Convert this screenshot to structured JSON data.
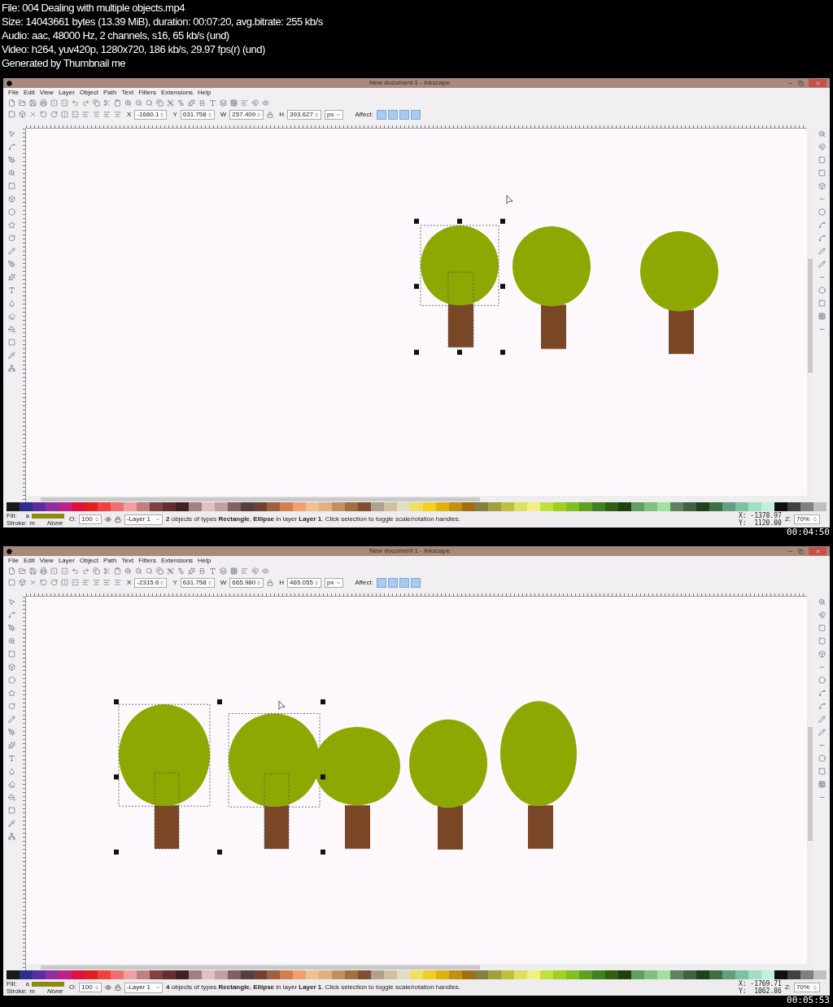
{
  "header": [
    "File: 004 Dealing with multiple objects.mp4",
    "Size: 14043661 bytes (13.39 MiB), duration: 00:07:20, avg.bitrate: 255 kb/s",
    "Audio: aac, 48000 Hz, 2 channels, s16, 65 kb/s (und)",
    "Video: h264, yuv420p, 1280x720, 186 kb/s, 29.97 fps(r) (und)",
    "Generated by Thumbnail me"
  ],
  "frames": [
    {
      "title": "New document 1 - Inkscape",
      "menu": [
        "File",
        "Edit",
        "View",
        "Layer",
        "Object",
        "Path",
        "Text",
        "Filters",
        "Extensions",
        "Help"
      ],
      "fields": [
        {
          "label": "X",
          "value": "-1660.1"
        },
        {
          "label": "Y",
          "value": "631.758"
        },
        {
          "label": "W",
          "value": "257.409"
        },
        {
          "label": "H",
          "value": "393.627"
        }
      ],
      "unit": "px",
      "affect": "Affect:",
      "fill_label": "Fill:",
      "fill_value": "a",
      "stroke_label": "Stroke:",
      "stroke_value": "m",
      "stroke_none": "None",
      "opacity_label": "O:",
      "opacity": "100",
      "layer": "-Layer 1",
      "status": "**2** objects of types **Rectangle**, **Ellipse** in layer **Layer 1**. Click selection to toggle scale/rotation handles.",
      "cursor_x": "X: -1378.97",
      "cursor_y": "Y:  1120.00",
      "zoom_label": "Z:",
      "zoom": "70%",
      "trees": [
        {
          "selected": true
        },
        {
          "selected": false
        },
        {
          "selected": false
        }
      ],
      "timestamp": "00:04:50"
    },
    {
      "title": "New document 1 - Inkscape",
      "menu": [
        "File",
        "Edit",
        "View",
        "Layer",
        "Object",
        "Path",
        "Text",
        "Filters",
        "Extensions",
        "Help"
      ],
      "fields": [
        {
          "label": "X",
          "value": "-2315.6"
        },
        {
          "label": "Y",
          "value": "631.758"
        },
        {
          "label": "W",
          "value": "665.980"
        },
        {
          "label": "H",
          "value": "465.055"
        }
      ],
      "unit": "px",
      "affect": "Affect:",
      "fill_label": "Fill:",
      "fill_value": "a",
      "stroke_label": "Stroke:",
      "stroke_value": "m",
      "stroke_none": "None",
      "opacity_label": "O:",
      "opacity": "100",
      "layer": "-Layer 1",
      "status": "**4** objects of types **Rectangle**, **Ellipse** in layer **Layer 1**. Click selection to toggle scale/rotation handles.",
      "cursor_x": "X: -1769.71",
      "cursor_y": "Y:  1062.86",
      "zoom_label": "Z:",
      "zoom": "70%",
      "trees": [
        {
          "selected": true
        },
        {
          "selected": true
        },
        {
          "selected": false
        },
        {
          "selected": false
        },
        {
          "selected": false
        }
      ],
      "timestamp": "00:05:53"
    }
  ]
}
